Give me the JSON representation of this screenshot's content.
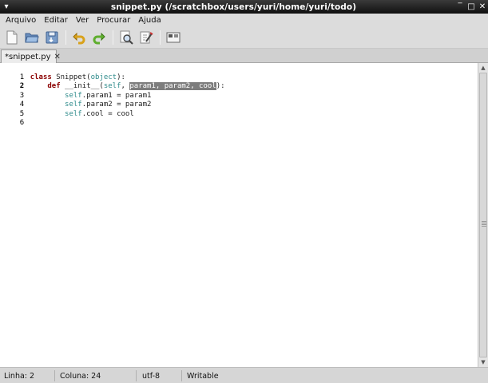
{
  "window": {
    "title": "snippet.py (/scratchbox/users/yuri/home/yuri/todo)",
    "app_menu_icon": "menu-icon",
    "controls": [
      "minimize-icon",
      "maximize-icon",
      "close-icon"
    ]
  },
  "menubar": {
    "items": [
      "Arquivo",
      "Editar",
      "Ver",
      "Procurar",
      "Ajuda"
    ]
  },
  "toolbar": {
    "buttons": [
      "new-file-icon",
      "open-file-icon",
      "save-file-icon",
      "undo-icon",
      "redo-icon",
      "find-icon",
      "replace-icon",
      "fullscreen-icon"
    ]
  },
  "tabs": [
    {
      "label": "*snippet.py",
      "close_icon": "close-icon"
    }
  ],
  "editor": {
    "current_line": 2,
    "lines": [
      {
        "num": "1"
      },
      {
        "num": "2"
      },
      {
        "num": "3"
      },
      {
        "num": "4"
      },
      {
        "num": "5"
      },
      {
        "num": "6"
      }
    ],
    "tokens": {
      "l1_class": "class",
      "l1_name": " Snippet(",
      "l1_object": "object",
      "l1_end": "):",
      "l2_def": "def",
      "l2_init": " __init__(",
      "l2_self": "self",
      "l2_comma": ", ",
      "l2_selected": "param1, param2, cool",
      "l2_end": "):",
      "l3_self": "self",
      "l3_rest": ".param1 = param1",
      "l4_self": "self",
      "l4_rest": ".param2 = param2",
      "l5_self": "self",
      "l5_rest": ".cool = cool"
    },
    "colors": {
      "keyword": "#8b0000",
      "builtin": "#2e8b8b",
      "selection": "#7d7d7d"
    }
  },
  "statusbar": {
    "line": "Linha: 2",
    "column": "Coluna: 24",
    "encoding": "utf-8",
    "mode": "Writable"
  }
}
